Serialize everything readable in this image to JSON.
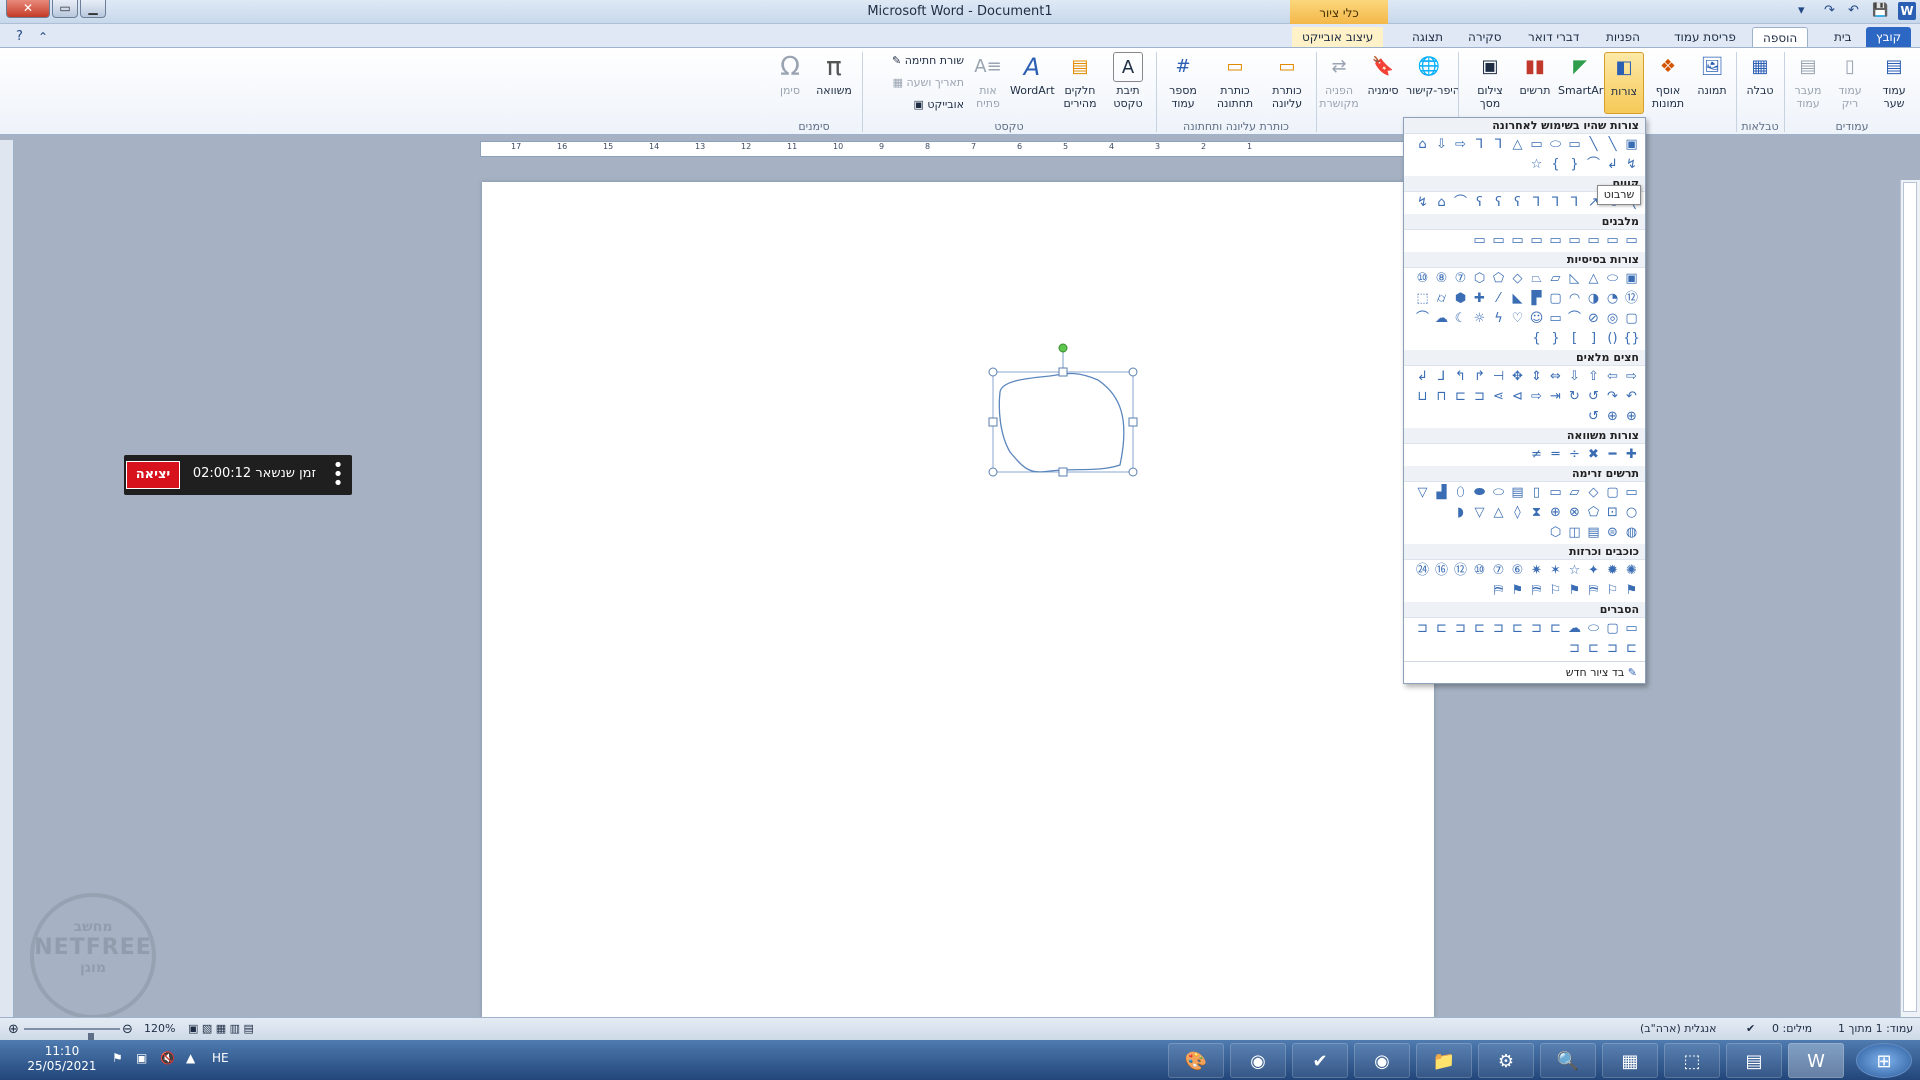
{
  "window": {
    "title": "Microsoft Word  -  Document1",
    "close_icon": "✕",
    "maximize_icon": "▭",
    "minimize_icon": "▁",
    "context_tab_header": "כלי ציור",
    "word_logo": "W"
  },
  "quick_access": {
    "save_icon": "💾",
    "undo_icon": "↶",
    "redo_icon": "↷",
    "customize_icon": "▾"
  },
  "tabs": {
    "file": "קובץ",
    "home": "בית",
    "insert": "הוספה",
    "page_layout": "פריסת עמוד",
    "references": "הפניות",
    "mailings": "דברי דואר",
    "review": "סקירה",
    "view": "תצוגה",
    "format": "עיצוב אובייקט"
  },
  "ribbon": {
    "cover_page": "עמוד שער",
    "blank_page": "עמוד ריק",
    "page_break": "מעבר עמוד",
    "group_pages": "עמודים",
    "table": "טבלה",
    "group_tables": "טבלאות",
    "picture": "תמונה",
    "clip_art": "אוסף תמונות",
    "shapes": "צורות",
    "smartart": "SmartArt",
    "chart": "תרשים",
    "screenshot": "צילום מסך",
    "hyperlink": "היפר-קישור",
    "bookmark": "סימניה",
    "cross_reference": "הפניה מקושרת",
    "group_links": "קישורים",
    "header": "כותרת עליונה",
    "footer": "כותרת תחתונה",
    "page_number": "מספר עמוד",
    "group_header_footer": "כותרת עליונה ותחתונה",
    "text_box": "תיבת טקסט",
    "quick_parts": "חלקים מהירים",
    "wordart": "WordArt",
    "drop_cap": "אות פתיח",
    "signature_line": "שורת חתימה",
    "date_time": "תאריך ושעה",
    "object": "אובייקט",
    "group_text": "טקסט",
    "equation": "משוואה",
    "symbol": "סימן",
    "group_symbols": "סימנים"
  },
  "ruler": {
    "ticks": [
      "17",
      "16",
      "15",
      "14",
      "13",
      "12",
      "11",
      "10",
      "9",
      "8",
      "7",
      "6",
      "5",
      "4",
      "3",
      "2",
      "1"
    ]
  },
  "gallery": {
    "recent": "צורות שהיו בשימוש לאחרונה",
    "lines": "קווים",
    "rectangles": "מלבנים",
    "basic": "צורות בסיסיות",
    "block_arrows": "חצים מלאים",
    "equation_shapes": "צורות משוואה",
    "flowchart": "תרשים זרימה",
    "stars": "כוכבים וכרזות",
    "callouts": "הסברים",
    "new_canvas": "בד ציור חדש",
    "tooltip": "שרבוט"
  },
  "timer": {
    "exit_label": "יציאה",
    "text": "זמן שנשאר 02:00:12"
  },
  "watermark": {
    "line1": "מחשב",
    "line2": "NETFREE",
    "line3": "מוגן"
  },
  "status": {
    "page": "עמוד: 1 מתוך 1",
    "words": "מילים: 0",
    "language": "אנגלית (ארה\"ב)",
    "zoom": "120%"
  },
  "taskbar": {
    "time": "11:10",
    "date": "25/05/2021",
    "lang": "HE"
  }
}
